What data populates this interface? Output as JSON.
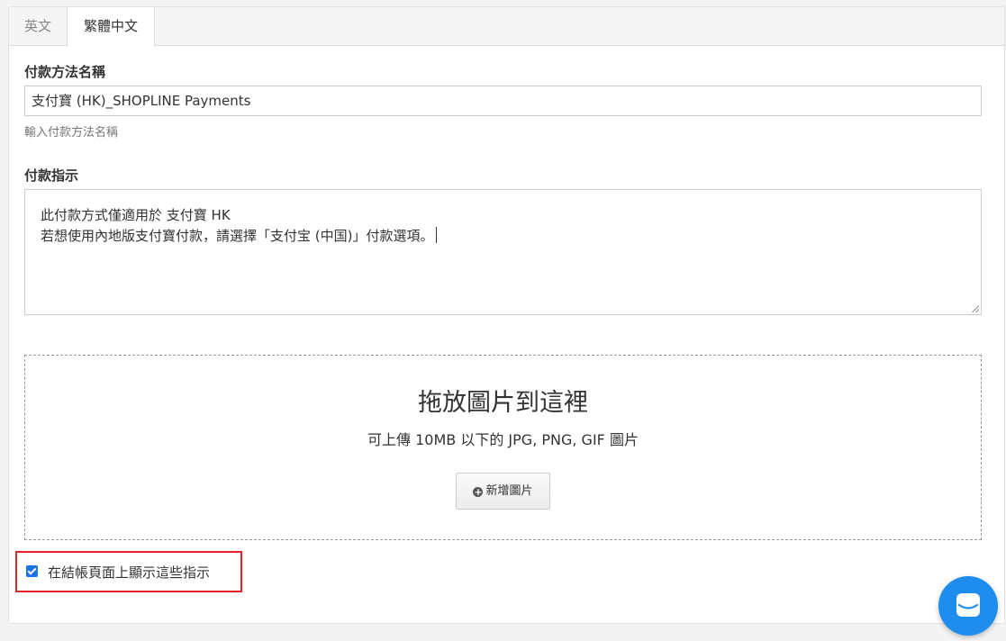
{
  "tabs": [
    {
      "label": "英文",
      "active": false
    },
    {
      "label": "繁體中文",
      "active": true
    }
  ],
  "payment_name": {
    "label": "付款方法名稱",
    "value": "支付寶 (HK)_SHOPLINE Payments",
    "help": "輸入付款方法名稱"
  },
  "instructions": {
    "label": "付款指示",
    "lines": [
      "此付款方式僅適用於 支付寶 HK",
      "若想使用內地版支付寶付款，請選擇「支付宝 (中国)」付款選項。"
    ]
  },
  "dropzone": {
    "title": "拖放圖片到這裡",
    "subtitle": "可上傳 10MB 以下的 JPG, PNG, GIF 圖片",
    "button_label": "新增圖片",
    "button_icon": "plus-circle-icon"
  },
  "show_instructions": {
    "label": "在結帳頁面上顯示這些指示",
    "checked": true
  },
  "chat": {
    "icon": "chat-icon",
    "color": "#1f8ded"
  },
  "colors": {
    "highlight_border": "#e0242a",
    "checkbox": "#1a73e8"
  }
}
